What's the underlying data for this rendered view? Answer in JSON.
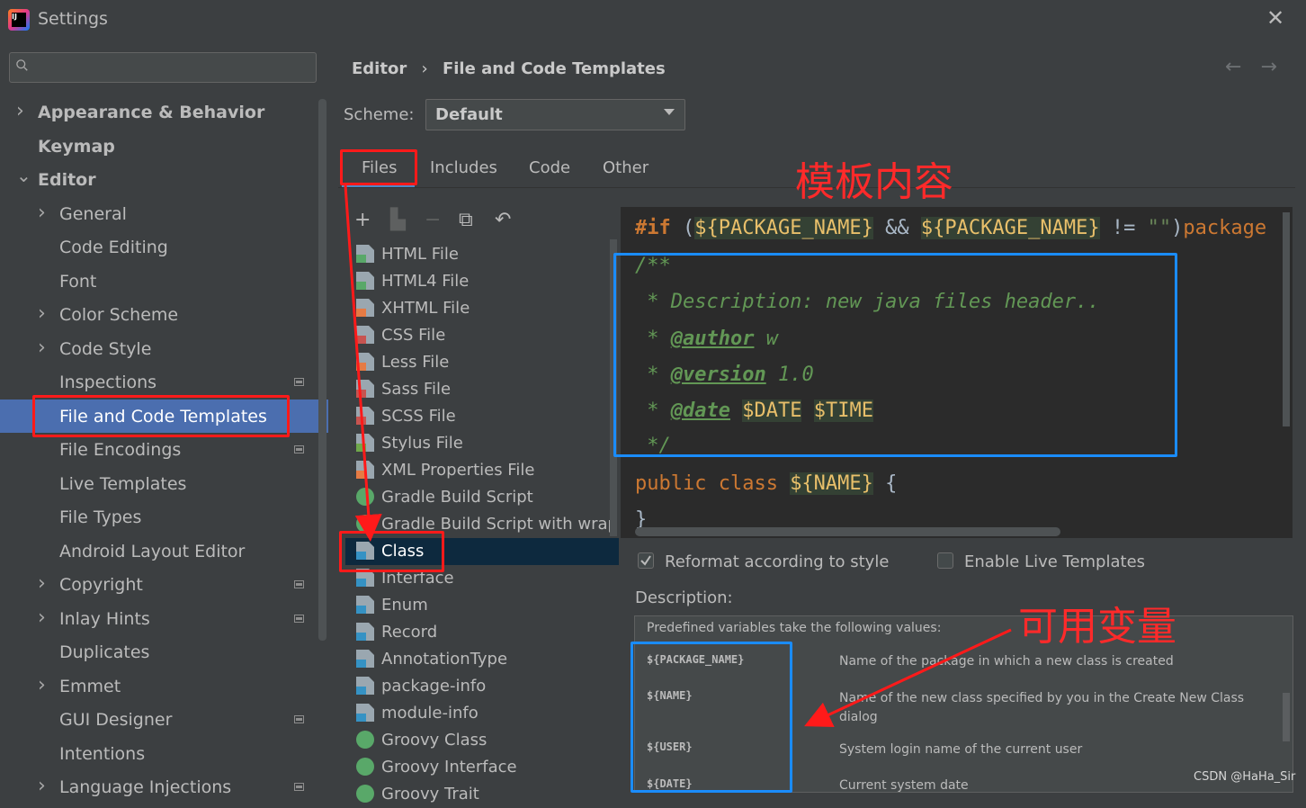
{
  "window": {
    "title": "Settings"
  },
  "search": {
    "placeholder": ""
  },
  "sidebar": {
    "items": [
      {
        "label": "Appearance & Behavior",
        "level": 0,
        "arrow": "right",
        "bold": true
      },
      {
        "label": "Keymap",
        "level": 0,
        "arrow": "none",
        "bold": true
      },
      {
        "label": "Editor",
        "level": 0,
        "arrow": "down",
        "bold": true
      },
      {
        "label": "General",
        "level": 1,
        "arrow": "right"
      },
      {
        "label": "Code Editing",
        "level": 1,
        "arrow": "none"
      },
      {
        "label": "Font",
        "level": 1,
        "arrow": "none"
      },
      {
        "label": "Color Scheme",
        "level": 1,
        "arrow": "right"
      },
      {
        "label": "Code Style",
        "level": 1,
        "arrow": "right"
      },
      {
        "label": "Inspections",
        "level": 1,
        "arrow": "none",
        "badge": true
      },
      {
        "label": "File and Code Templates",
        "level": 1,
        "arrow": "none",
        "selected": true
      },
      {
        "label": "File Encodings",
        "level": 1,
        "arrow": "none",
        "badge": true
      },
      {
        "label": "Live Templates",
        "level": 1,
        "arrow": "none"
      },
      {
        "label": "File Types",
        "level": 1,
        "arrow": "none"
      },
      {
        "label": "Android Layout Editor",
        "level": 1,
        "arrow": "none"
      },
      {
        "label": "Copyright",
        "level": 1,
        "arrow": "right",
        "badge": true
      },
      {
        "label": "Inlay Hints",
        "level": 1,
        "arrow": "right",
        "badge": true
      },
      {
        "label": "Duplicates",
        "level": 1,
        "arrow": "none"
      },
      {
        "label": "Emmet",
        "level": 1,
        "arrow": "right"
      },
      {
        "label": "GUI Designer",
        "level": 1,
        "arrow": "none",
        "badge": true
      },
      {
        "label": "Intentions",
        "level": 1,
        "arrow": "none"
      },
      {
        "label": "Language Injections",
        "level": 1,
        "arrow": "right",
        "badge": true
      }
    ]
  },
  "breadcrumb": {
    "parent": "Editor",
    "sep": "›",
    "current": "File and Code Templates"
  },
  "scheme": {
    "label": "Scheme:",
    "value": "Default"
  },
  "tabs": [
    "Files",
    "Includes",
    "Code",
    "Other"
  ],
  "file_list": [
    {
      "label": "HTML File",
      "icon": "h"
    },
    {
      "label": "HTML4 File",
      "icon": "h"
    },
    {
      "label": "XHTML File",
      "icon": "xh"
    },
    {
      "label": "CSS File",
      "icon": "css"
    },
    {
      "label": "Less File",
      "icon": "xh"
    },
    {
      "label": "Sass File",
      "icon": "css"
    },
    {
      "label": "SCSS File",
      "icon": "css"
    },
    {
      "label": "Stylus File",
      "icon": "sty"
    },
    {
      "label": "XML Properties File",
      "icon": "xml"
    },
    {
      "label": "Gradle Build Script",
      "icon": "gr"
    },
    {
      "label": "Gradle Build Script with wrapper",
      "icon": "gr"
    },
    {
      "label": "Class",
      "icon": "j",
      "selected": true
    },
    {
      "label": "Interface",
      "icon": "j"
    },
    {
      "label": "Enum",
      "icon": "j"
    },
    {
      "label": "Record",
      "icon": "j"
    },
    {
      "label": "AnnotationType",
      "icon": "j"
    },
    {
      "label": "package-info",
      "icon": "j"
    },
    {
      "label": "module-info",
      "icon": "j"
    },
    {
      "label": "Groovy Class",
      "icon": "gr"
    },
    {
      "label": "Groovy Interface",
      "icon": "gr"
    },
    {
      "label": "Groovy Trait",
      "icon": "gr"
    }
  ],
  "editor": {
    "line1": {
      "kw": "#if",
      "p1": " (",
      "v1": "${PACKAGE_NAME}",
      "p2": " && ",
      "v2": "${PACKAGE_NAME}",
      "p3": " != ",
      "s": "\"\"",
      "p4": ")",
      "kw2": "package"
    },
    "line2": "/**",
    "line3": " * Description: new java files header..",
    "line4": {
      "pre": " * ",
      "tag": "@author",
      "val": " w"
    },
    "line5": {
      "pre": " * ",
      "tag": "@version",
      "val": " 1.0"
    },
    "line6": {
      "pre": " * ",
      "tag": "@date",
      "v1": "$DATE",
      "v2": "$TIME"
    },
    "line7": " */",
    "line8": {
      "kw": "public class ",
      "v": "${NAME}",
      "p": " {"
    },
    "line9": "}"
  },
  "options": {
    "reformat": "Reformat according to style",
    "live": "Enable Live Templates",
    "reformat_checked": true,
    "live_checked": false
  },
  "description": {
    "label": "Description:",
    "intro": "Predefined variables take the following values:",
    "vars": [
      {
        "name": "${PACKAGE_NAME}",
        "desc": "Name of the package in which a new class is created"
      },
      {
        "name": "${NAME}",
        "desc": "Name of the new class specified by you in the Create New Class dialog"
      },
      {
        "name": "${USER}",
        "desc": "System login name of the current user"
      },
      {
        "name": "${DATE}",
        "desc": "Current system date"
      }
    ]
  },
  "annotations": {
    "template_content": "模板内容",
    "available_vars": "可用变量"
  },
  "watermark": "CSDN @HaHa_Sir",
  "colors": {
    "accent": "#4a88c7",
    "selection": "#4b6eaf",
    "annotation_red": "#ff1a1a",
    "annotation_blue": "#1a8cff"
  }
}
